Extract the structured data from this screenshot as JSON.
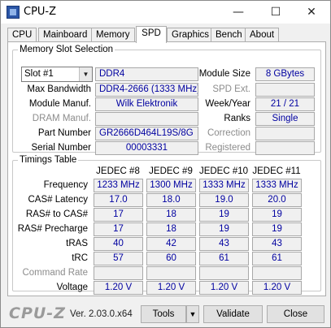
{
  "window": {
    "title": "CPU-Z",
    "min_glyph": "—",
    "max_glyph": "☐",
    "close_glyph": "✕"
  },
  "tabs": [
    "CPU",
    "Mainboard",
    "Memory",
    "SPD",
    "Graphics",
    "Bench",
    "About"
  ],
  "active_tab": "SPD",
  "slot_section": {
    "title": "Memory Slot Selection",
    "slot_selected": "Slot #1",
    "memory_type": "DDR4",
    "module_size_label": "Module Size",
    "module_size": "8 GBytes",
    "max_bandwidth_label": "Max Bandwidth",
    "max_bandwidth": "DDR4-2666 (1333 MHz)",
    "spd_ext_label": "SPD Ext.",
    "spd_ext": "",
    "module_manuf_label": "Module Manuf.",
    "module_manuf": "Wilk Elektronik",
    "week_year_label": "Week/Year",
    "week_year": "21 / 21",
    "dram_manuf_label": "DRAM Manuf.",
    "dram_manuf": "",
    "ranks_label": "Ranks",
    "ranks": "Single",
    "part_number_label": "Part Number",
    "part_number": "GR2666D464L19S/8G",
    "correction_label": "Correction",
    "correction": "",
    "serial_number_label": "Serial Number",
    "serial_number": "00003331",
    "registered_label": "Registered",
    "registered": ""
  },
  "timings": {
    "title": "Timings Table",
    "columns": [
      "JEDEC #8",
      "JEDEC #9",
      "JEDEC #10",
      "JEDEC #11"
    ],
    "rows": [
      {
        "label": "Frequency",
        "dim": false,
        "values": [
          "1233 MHz",
          "1300 MHz",
          "1333 MHz",
          "1333 MHz"
        ]
      },
      {
        "label": "CAS# Latency",
        "dim": false,
        "values": [
          "17.0",
          "18.0",
          "19.0",
          "20.0"
        ]
      },
      {
        "label": "RAS# to CAS#",
        "dim": false,
        "values": [
          "17",
          "18",
          "19",
          "19"
        ]
      },
      {
        "label": "RAS# Precharge",
        "dim": false,
        "values": [
          "17",
          "18",
          "19",
          "19"
        ]
      },
      {
        "label": "tRAS",
        "dim": false,
        "values": [
          "40",
          "42",
          "43",
          "43"
        ]
      },
      {
        "label": "tRC",
        "dim": false,
        "values": [
          "57",
          "60",
          "61",
          "61"
        ]
      },
      {
        "label": "Command Rate",
        "dim": true,
        "values": [
          "",
          "",
          "",
          ""
        ]
      },
      {
        "label": "Voltage",
        "dim": false,
        "values": [
          "1.20 V",
          "1.20 V",
          "1.20 V",
          "1.20 V"
        ]
      }
    ]
  },
  "footer": {
    "logo": "CPU-Z",
    "version": "Ver. 2.03.0.x64",
    "tools_label": "Tools",
    "tools_arrow": "▼",
    "validate_label": "Validate",
    "close_label": "Close"
  },
  "colors": {
    "value_text": "#0000a0",
    "dim_label": "#8c8c8c"
  }
}
